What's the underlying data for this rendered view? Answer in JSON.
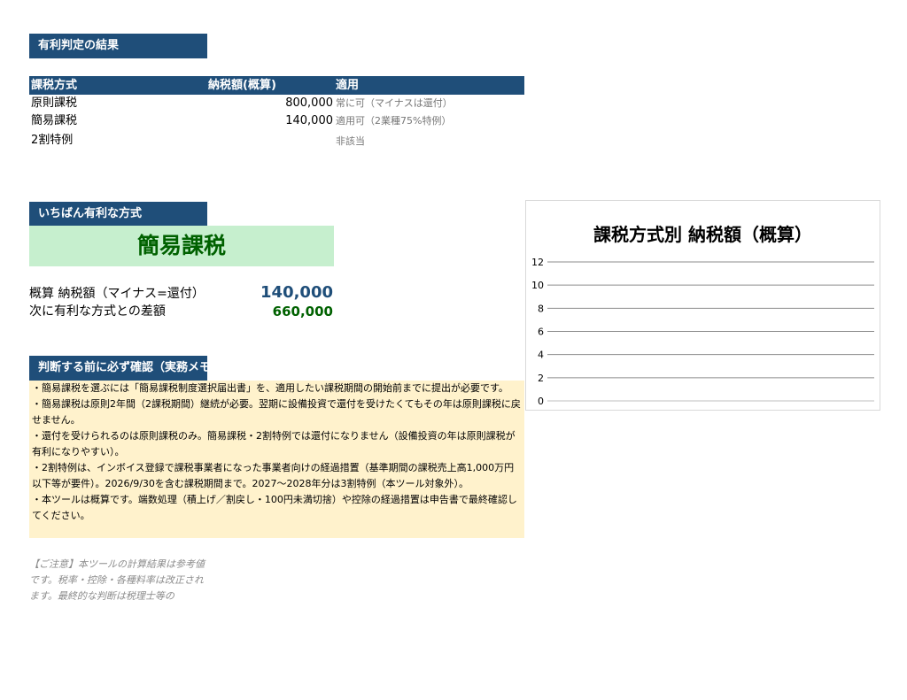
{
  "result_section": {
    "header": "有利判定の結果"
  },
  "table": {
    "headers": [
      "課税方式",
      "納税額(概算)",
      "適用"
    ],
    "rows": [
      {
        "method": "原則課税",
        "amount": "800,000",
        "note": "常に可（マイナスは還付）"
      },
      {
        "method": "簡易課税",
        "amount": "140,000",
        "note": "適用可（2業種75%特例）"
      },
      {
        "method": "2割特例",
        "amount": "",
        "note": "非該当"
      }
    ]
  },
  "best_section": {
    "header": "いちばん有利な方式",
    "best_method": "簡易課税",
    "tax_label": "概算 納税額（マイナス=還付）",
    "tax_value": "140,000",
    "diff_label": "次に有利な方式との差額",
    "diff_value": "660,000",
    "colors": {
      "tax_value": "#1f4e79",
      "diff_value": "#006100"
    }
  },
  "check_section": {
    "header": "判断する前に必ず確認（実務メモ）",
    "notes": [
      "・簡易課税を選ぶには「簡易課税制度選択届出書」を、適用したい課税期間の開始前までに提出が必要です。",
      "・簡易課税は原則2年間（2課税期間）継続が必要。翌期に設備投資で還付を受けたくてもその年は原則課税に戻せません。",
      "・還付を受けられるのは原則課税のみ。簡易課税・2割特例では還付になりません（設備投資の年は原則課税が有利になりやすい）。",
      "・2割特例は、インボイス登録で課税事業者になった事業者向けの経過措置（基準期間の課税売上高1,000万円以下等が要件）。2026/9/30を含む課税期間まで。2027〜2028年分は3割特例（本ツール対象外）。",
      "・本ツールは概算です。端数処理（積上げ／割戻し・100円未満切捨）や控除の経過措置は申告書で最終確認してください。"
    ]
  },
  "caution": "【ご注意】本ツールの計算結果は参考値です。税率・控除・各種料率は改正されます。最終的な判断は税理士等の",
  "chart_data": {
    "type": "bar",
    "title": "課税方式別 納税額（概算）",
    "categories": [],
    "series": [],
    "ylim": [
      0,
      12
    ],
    "yticks": [
      "0",
      "2",
      "4",
      "6",
      "8",
      "10",
      "12"
    ],
    "grid": true
  }
}
